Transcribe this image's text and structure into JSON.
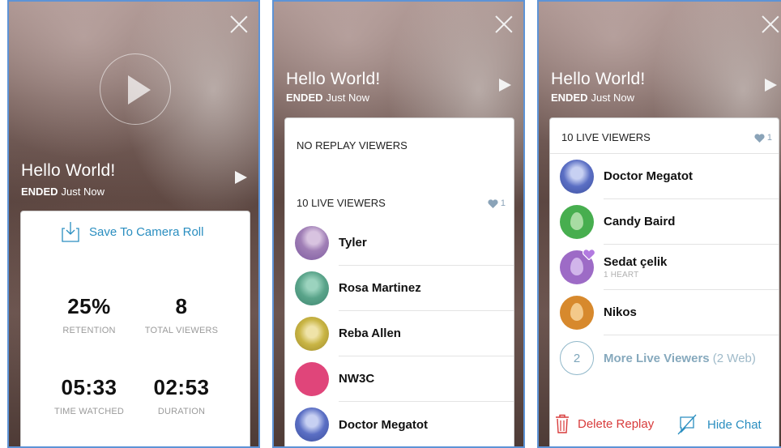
{
  "screens": [
    {
      "title": "Hello World!",
      "status_label": "ENDED",
      "status_time": "Just Now",
      "save_label": "Save To Camera Roll",
      "stats": [
        {
          "value": "25%",
          "label": "RETENTION"
        },
        {
          "value": "8",
          "label": "TOTAL VIEWERS"
        },
        {
          "value": "05:33",
          "label": "TIME WATCHED"
        },
        {
          "value": "02:53",
          "label": "DURATION"
        }
      ]
    },
    {
      "title": "Hello World!",
      "status_label": "ENDED",
      "status_time": "Just Now",
      "replay_header": "NO REPLAY VIEWERS",
      "live_header": "10 LIVE VIEWERS",
      "hearts": "1",
      "viewers": [
        {
          "name": "Tyler",
          "color": "#a07fb6"
        },
        {
          "name": "Rosa Martinez",
          "color": "#5aa48a"
        },
        {
          "name": "Reba Allen",
          "color": "#c9b545"
        },
        {
          "name": "NW3C",
          "color": "#e0457a"
        },
        {
          "name": "Doctor Megatot",
          "color": "#5b6fc4"
        }
      ]
    },
    {
      "title": "Hello World!",
      "status_label": "ENDED",
      "status_time": "Just Now",
      "live_header": "10 LIVE VIEWERS",
      "hearts": "1",
      "viewers": [
        {
          "name": "Doctor Megatot",
          "sub": "",
          "color": "#5b6fc4"
        },
        {
          "name": "Candy Baird",
          "sub": "",
          "color": "#47ae4f",
          "egg": "#a8dca3"
        },
        {
          "name": "Sedat çelik",
          "sub": "1 HEART",
          "color": "#9d6bc6",
          "egg": "#d1b5ea"
        },
        {
          "name": "Nikos",
          "sub": "",
          "color": "#d7892d",
          "egg": "#f3c98a"
        }
      ],
      "more_count": "2",
      "more_label": "More Live Viewers",
      "more_web": "(2 Web)",
      "delete_label": "Delete Replay",
      "hide_label": "Hide Chat"
    }
  ],
  "colors": {
    "accent": "#2a8ec0",
    "delete": "#d83b3b",
    "heart": "#8aa3b8"
  }
}
